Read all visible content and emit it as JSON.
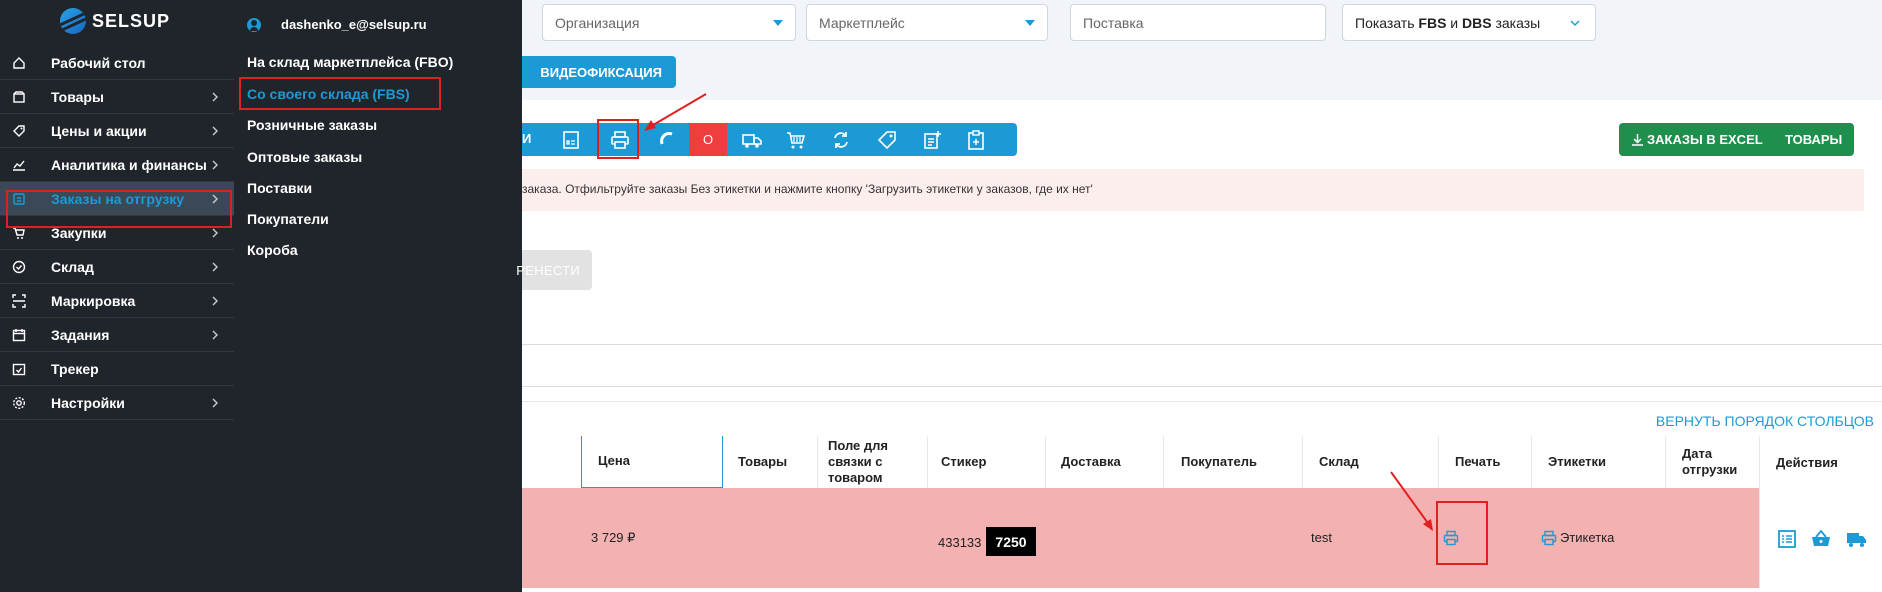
{
  "brand": {
    "logo_text": "SELSUP",
    "logo_icon": "selsup-logo-icon",
    "accent": "#1c9ad6",
    "sidebar_bg": "#20252b"
  },
  "sidebar": {
    "items": [
      {
        "label": "Рабочий стол",
        "icon": "dashboard-icon",
        "chevron": false,
        "active": false
      },
      {
        "label": "Товары",
        "icon": "box-icon",
        "chevron": true,
        "active": false
      },
      {
        "label": "Цены и акции",
        "icon": "tag-icon",
        "chevron": true,
        "active": false
      },
      {
        "label": "Аналитика и финансы",
        "icon": "chart-icon",
        "chevron": true,
        "active": false
      },
      {
        "label": "Заказы на отгрузку",
        "icon": "orders-icon",
        "chevron": true,
        "active": true
      },
      {
        "label": "Закупки",
        "icon": "cart-icon",
        "chevron": true,
        "active": false
      },
      {
        "label": "Склад",
        "icon": "check-circle-icon",
        "chevron": true,
        "active": false
      },
      {
        "label": "Маркировка",
        "icon": "scan-icon",
        "chevron": true,
        "active": false
      },
      {
        "label": "Задания",
        "icon": "calendar-icon",
        "chevron": true,
        "active": false
      },
      {
        "label": "Трекер",
        "icon": "tracker-icon",
        "chevron": false,
        "active": false
      },
      {
        "label": "Настройки",
        "icon": "gear-icon",
        "chevron": true,
        "active": false
      }
    ]
  },
  "submenu": {
    "user_email": "dashenko_e@selsup.ru",
    "items": [
      {
        "label": "На склад маркетплейса (FBO)",
        "active": false
      },
      {
        "label": "Со своего склада (FBS)",
        "active": true
      },
      {
        "label": "Розничные заказы",
        "active": false
      },
      {
        "label": "Оптовые заказы",
        "active": false
      },
      {
        "label": "Поставки",
        "active": false
      },
      {
        "label": "Покупатели",
        "active": false
      },
      {
        "label": "Короба",
        "active": false
      }
    ]
  },
  "filters": {
    "organization_placeholder": "Организация",
    "marketplace_placeholder": "Маркетплейс",
    "supply_placeholder": "Поставка",
    "show_prefix": "Показать ",
    "show_fbs": "FBS",
    "show_and": " и ",
    "show_dbs": "DBS",
    "show_suffix": " заказы"
  },
  "buttons": {
    "video": "ВИДЕОФИКСАЦИЯ",
    "toolbar_cut": "И",
    "toolbar_red": "О",
    "excel": "ЗАКАЗЫ В EXCEL",
    "goods": "ТОВАРЫ",
    "move": "РЕНЕСТИ",
    "restore_columns": "ВЕРНУТЬ ПОРЯДОК СТОЛБЦОВ"
  },
  "toolbar_icons": [
    "pdf-icon",
    "print-icon",
    "refresh-curve-icon",
    "truck-icon",
    "basket-icon",
    "sync-icon",
    "tag-icon",
    "note-add-icon",
    "clipboard-icon"
  ],
  "alert": {
    "text": "заказа. Отфильтруйте заказы Без этикетки и нажмите кнопку 'Загрузить этикетки у заказов, где их нет'"
  },
  "table": {
    "headers": {
      "price": "Цена",
      "goods": "Товары",
      "link_field": "Поле для связки с товаром",
      "sticker": "Стикер",
      "delivery": "Доставка",
      "buyer": "Покупатель",
      "warehouse": "Склад",
      "print": "Печать",
      "labels": "Этикетки",
      "ship_date": "Дата отгрузки",
      "actions": "Действия"
    },
    "row": {
      "price": "3 729 ₽",
      "sticker_number": "433133",
      "sticker_badge": "7250",
      "warehouse": "test",
      "label_link": "Этикетка"
    },
    "row_color": "#f3b1b1"
  },
  "annotation_color": "#e02020"
}
